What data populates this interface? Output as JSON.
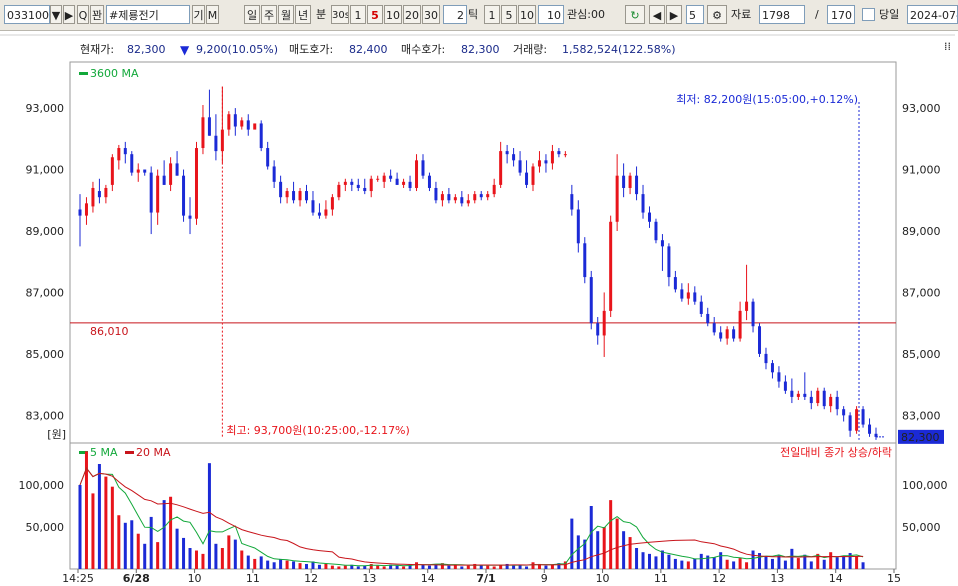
{
  "toolbar": {
    "code": "033100",
    "search_icon_label": "Q",
    "view_label": "꽌",
    "stock_name": "#제룡전기",
    "gi_label": "기",
    "m_label": "M",
    "period_day": "일",
    "period_week": "주",
    "period_month": "월",
    "period_year": "년",
    "minute_label": "분",
    "interval_30s": "30s",
    "interval_1": "1",
    "interval_5": "5",
    "interval_10": "10",
    "interval_20": "20",
    "interval_30": "30",
    "tick_value": "2",
    "tick_label": "틱",
    "tick_1": "1",
    "tick_5": "5",
    "tick_10": "10",
    "tick_custom": "10",
    "interest_label": "관심:00",
    "count_value": "5",
    "data_label": "자료",
    "data_count": "1798",
    "slash": "/",
    "page_value": "170",
    "today_label": "당일",
    "date_value": "2024-07-"
  },
  "info": {
    "current_label": "현재가:",
    "current_value": "82,300",
    "change_value": "9,200(10.05%)",
    "ask_label": "매도호가:",
    "ask_value": "82,400",
    "bid_label": "매수호가:",
    "bid_value": "82,300",
    "volume_label": "거래량:",
    "volume_value": "1,582,524(122.58%)"
  },
  "colors": {
    "up": "#e8141b",
    "down": "#1b2ad6",
    "ma3600": "#12a83a",
    "ma5": "#12a83a",
    "ma20": "#c8141b",
    "ref_line": "#c8141b",
    "last_price_box": "#1b2ad6"
  },
  "chart_data": [
    {
      "type": "candlestick",
      "legend": "3600 MA",
      "y_ticks": [
        83000,
        85000,
        87000,
        89000,
        91000,
        93000
      ],
      "y_tick_labels": [
        "83,000",
        "85,000",
        "87,000",
        "89,000",
        "91,000",
        "93,000"
      ],
      "ylim": [
        82100,
        94500
      ],
      "y_unit_label": "[원]",
      "reference_line": {
        "value": 86010,
        "label": "86,010"
      },
      "high": {
        "value": 93700,
        "label": "최고: 93,700원(10:25:00,-12.17%)"
      },
      "low": {
        "value": 82200,
        "label": "최저: 82,200원(15:05:00,+0.12%)"
      },
      "last_price": {
        "value": 82300,
        "label": "82,300"
      },
      "candles": [
        [
          89700,
          90200,
          88500,
          89500
        ],
        [
          89500,
          90100,
          89200,
          89900
        ],
        [
          89800,
          90600,
          89600,
          90400
        ],
        [
          90300,
          90700,
          89900,
          90100
        ],
        [
          90100,
          90500,
          89900,
          90400
        ],
        [
          90500,
          91500,
          90300,
          91400
        ],
        [
          91300,
          91800,
          91000,
          91700
        ],
        [
          91700,
          91900,
          91200,
          91500
        ],
        [
          91500,
          91600,
          90800,
          90900
        ],
        [
          90900,
          91200,
          90600,
          91000
        ],
        [
          91000,
          91000,
          90800,
          90900
        ],
        [
          90900,
          91100,
          88900,
          89600
        ],
        [
          89600,
          91000,
          89200,
          90800
        ],
        [
          90800,
          91300,
          90500,
          90500
        ],
        [
          90500,
          91400,
          90300,
          91200
        ],
        [
          91200,
          91600,
          90800,
          90800
        ],
        [
          90800,
          91000,
          89300,
          89500
        ],
        [
          89500,
          90100,
          88900,
          89400
        ],
        [
          89400,
          91900,
          89200,
          91700
        ],
        [
          91700,
          93100,
          91500,
          92700
        ],
        [
          92700,
          93600,
          92100,
          92100
        ],
        [
          92100,
          92800,
          91300,
          91600
        ],
        [
          91600,
          93700,
          91200,
          92300
        ],
        [
          92300,
          92900,
          92100,
          92800
        ],
        [
          92800,
          93000,
          92100,
          92400
        ],
        [
          92400,
          92700,
          92300,
          92600
        ],
        [
          92600,
          92800,
          92100,
          92300
        ],
        [
          92300,
          92500,
          92400,
          92500
        ],
        [
          92500,
          92600,
          91600,
          91700
        ],
        [
          91700,
          91900,
          91000,
          91100
        ],
        [
          91100,
          91300,
          90400,
          90600
        ],
        [
          90600,
          90800,
          89900,
          90100
        ],
        [
          90100,
          90400,
          89900,
          90300
        ],
        [
          90300,
          90600,
          89900,
          90000
        ],
        [
          90000,
          90400,
          89800,
          90300
        ],
        [
          90300,
          90500,
          89900,
          90000
        ],
        [
          90000,
          90300,
          89500,
          89600
        ],
        [
          89600,
          89900,
          89400,
          89500
        ],
        [
          89500,
          90000,
          89400,
          89700
        ],
        [
          89700,
          90200,
          89500,
          90100
        ],
        [
          90100,
          90600,
          90000,
          90500
        ],
        [
          90500,
          90700,
          90300,
          90600
        ],
        [
          90600,
          90700,
          90300,
          90500
        ],
        [
          90500,
          90700,
          90300,
          90400
        ],
        [
          90400,
          90700,
          90200,
          90300
        ],
        [
          90300,
          90800,
          90100,
          90700
        ],
        [
          90700,
          90800,
          90600,
          90700
        ],
        [
          90600,
          90900,
          90400,
          90800
        ],
        [
          90800,
          91000,
          90600,
          90700
        ],
        [
          90700,
          90900,
          90500,
          90500
        ],
        [
          90500,
          90700,
          90400,
          90600
        ],
        [
          90600,
          90800,
          90300,
          90400
        ],
        [
          90400,
          91500,
          90300,
          91300
        ],
        [
          91300,
          91500,
          90700,
          90800
        ],
        [
          90800,
          90900,
          90300,
          90400
        ],
        [
          90400,
          90600,
          89900,
          90000
        ],
        [
          90000,
          90300,
          89800,
          90200
        ],
        [
          90200,
          90400,
          89900,
          90000
        ],
        [
          90000,
          90200,
          89900,
          90100
        ],
        [
          90100,
          90300,
          89800,
          89900
        ],
        [
          89900,
          90200,
          89800,
          90000
        ],
        [
          90000,
          90300,
          89900,
          90200
        ],
        [
          90200,
          90300,
          90000,
          90100
        ],
        [
          90100,
          90300,
          90000,
          90200
        ],
        [
          90200,
          90700,
          90100,
          90500
        ],
        [
          90500,
          91900,
          90400,
          91600
        ],
        [
          91600,
          91800,
          91200,
          91500
        ],
        [
          91500,
          91700,
          91100,
          91300
        ],
        [
          91300,
          91600,
          90800,
          90900
        ],
        [
          90900,
          91300,
          90400,
          90500
        ],
        [
          90500,
          91200,
          90300,
          91100
        ],
        [
          91100,
          91600,
          90900,
          91300
        ],
        [
          91300,
          91500,
          90900,
          91200
        ],
        [
          91200,
          91800,
          91000,
          91600
        ],
        [
          91600,
          91700,
          91400,
          91500
        ],
        [
          91500,
          91600,
          91400,
          91500
        ],
        [
          90200,
          90500,
          89500,
          89700
        ],
        [
          89700,
          90000,
          88300,
          88600
        ],
        [
          88600,
          88800,
          87300,
          87500
        ],
        [
          87500,
          87700,
          85800,
          86000
        ],
        [
          86000,
          86200,
          85300,
          85600
        ],
        [
          85600,
          87000,
          84900,
          86400
        ],
        [
          86400,
          89500,
          86200,
          89300
        ],
        [
          89300,
          91500,
          89000,
          90800
        ],
        [
          90800,
          91200,
          90100,
          90400
        ],
        [
          90400,
          90900,
          90200,
          90800
        ],
        [
          90800,
          91100,
          90000,
          90200
        ],
        [
          90200,
          90500,
          89400,
          89600
        ],
        [
          89600,
          89800,
          89100,
          89300
        ],
        [
          89300,
          89400,
          88600,
          88700
        ],
        [
          88700,
          88900,
          87700,
          88500
        ],
        [
          88500,
          88600,
          87200,
          87500
        ],
        [
          87500,
          87700,
          87000,
          87100
        ],
        [
          87100,
          87300,
          86700,
          86800
        ],
        [
          86800,
          87300,
          86600,
          87000
        ],
        [
          87000,
          87200,
          86600,
          86700
        ],
        [
          86700,
          86900,
          86200,
          86300
        ],
        [
          86300,
          86500,
          85900,
          86000
        ],
        [
          86000,
          86200,
          85600,
          85700
        ],
        [
          85700,
          85900,
          85400,
          85500
        ],
        [
          85500,
          85900,
          85300,
          85800
        ],
        [
          85800,
          85900,
          85400,
          85500
        ],
        [
          85500,
          86700,
          85400,
          86400
        ],
        [
          86400,
          87900,
          86100,
          86700
        ],
        [
          86700,
          86800,
          85700,
          85900
        ],
        [
          85900,
          86000,
          84900,
          85000
        ],
        [
          85000,
          85200,
          84500,
          84700
        ],
        [
          84700,
          84800,
          84200,
          84400
        ],
        [
          84400,
          84600,
          83900,
          84100
        ],
        [
          84100,
          84300,
          83700,
          83800
        ],
        [
          83800,
          84200,
          83400,
          83600
        ],
        [
          83600,
          83800,
          83500,
          83700
        ],
        [
          83700,
          84400,
          83500,
          83600
        ],
        [
          83600,
          83800,
          83200,
          83400
        ],
        [
          83400,
          83900,
          83300,
          83800
        ],
        [
          83800,
          83900,
          83200,
          83300
        ],
        [
          83300,
          83700,
          83100,
          83600
        ],
        [
          83600,
          83800,
          83000,
          83200
        ],
        [
          83200,
          83300,
          82800,
          83000
        ],
        [
          83000,
          83100,
          82300,
          82500
        ],
        [
          82500,
          83300,
          82400,
          83200
        ],
        [
          83200,
          83300,
          82600,
          82700
        ],
        [
          82700,
          82900,
          82300,
          82400
        ],
        [
          82400,
          82600,
          82200,
          82300
        ]
      ]
    },
    {
      "type": "bar",
      "legend": [
        "5 MA",
        "20 MA"
      ],
      "right_label": "전일대비 종가 상승/하락",
      "y_ticks": [
        50000,
        100000
      ],
      "y_tick_labels": [
        "50,000",
        "100,000"
      ],
      "ylim": [
        0,
        150000
      ],
      "x_tick_labels": [
        "14:25",
        "6/28",
        "10",
        "11",
        "12",
        "13",
        "14",
        "7/1",
        "9",
        "10",
        "11",
        "12",
        "13",
        "14",
        "15"
      ],
      "volumes": [
        100000,
        140000,
        90000,
        125000,
        110000,
        98000,
        64000,
        55000,
        58000,
        42000,
        30000,
        62000,
        32000,
        82000,
        86000,
        48000,
        37000,
        25000,
        22000,
        18000,
        126000,
        30000,
        25000,
        40000,
        35000,
        22000,
        16000,
        12000,
        15000,
        10000,
        8000,
        12000,
        10000,
        9000,
        7000,
        6000,
        9000,
        5000,
        6000,
        4000,
        3000,
        4000,
        5000,
        3000,
        4000,
        6000,
        4000,
        3000,
        5000,
        4000,
        3000,
        6000,
        8000,
        5000,
        4000,
        6000,
        7000,
        4000,
        5000,
        3000,
        4000,
        6000,
        5000,
        4000,
        3000,
        5000,
        6000,
        4000,
        5000,
        3000,
        8000,
        6000,
        4000,
        5000,
        7000,
        9000,
        60000,
        40000,
        35000,
        75000,
        45000,
        50000,
        82000,
        60000,
        45000,
        38000,
        25000,
        20000,
        18000,
        15000,
        22000,
        17000,
        12000,
        10000,
        9000,
        12000,
        18000,
        16000,
        14000,
        20000,
        11000,
        9000,
        13000,
        8000,
        22000,
        19000,
        15000,
        12000,
        16000,
        10000,
        24000,
        13000,
        17000,
        9000,
        18000,
        11000,
        20000,
        14000,
        16000,
        19000,
        15000,
        8000
      ]
    }
  ]
}
